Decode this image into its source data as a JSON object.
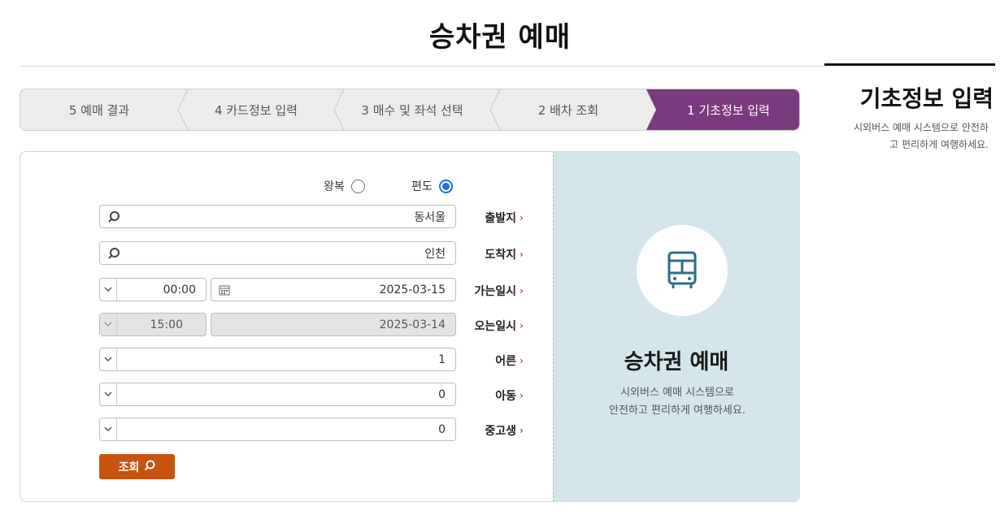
{
  "page_title": "승차권 예매",
  "steps": [
    {
      "label": "1 기초정보 입력",
      "active": true
    },
    {
      "label": "2 배차 조회",
      "active": false
    },
    {
      "label": "3 매수 및 좌석 선택",
      "active": false
    },
    {
      "label": "4 카드정보 입력",
      "active": false
    },
    {
      "label": "5 예매 결과",
      "active": false
    }
  ],
  "trip_type": {
    "oneway": "편도",
    "roundtrip": "왕복",
    "selected": "oneway"
  },
  "fields": {
    "departure": {
      "label": "출발지",
      "value": "동서울"
    },
    "arrival": {
      "label": "도착지",
      "value": "인천"
    },
    "go_datetime": {
      "label": "가는일시",
      "date": "2025-03-15",
      "time": "00:00"
    },
    "return_datetime": {
      "label": "오는일시",
      "date": "2025-03-14",
      "time": "15:00"
    },
    "adult": {
      "label": "어른",
      "value": "1"
    },
    "child": {
      "label": "아동",
      "value": "0"
    },
    "student": {
      "label": "중고생",
      "value": "0"
    }
  },
  "search_button": "조회",
  "info_panel": {
    "title": "승차권 예매",
    "desc_line1": "시외버스 예매 시스템으로",
    "desc_line2": "안전하고 편리하게 여행하세요."
  },
  "side": {
    "title": "기초정보 입력",
    "desc_line1": "시외버스 예매 시스템으로 안전하",
    "desc_line2": "고 편리하게 여행하세요."
  },
  "colors": {
    "accent_purple": "#7a3a7e",
    "button_orange": "#c8530f",
    "info_bg": "#d4e6ec",
    "radio_blue": "#1a73e8"
  }
}
